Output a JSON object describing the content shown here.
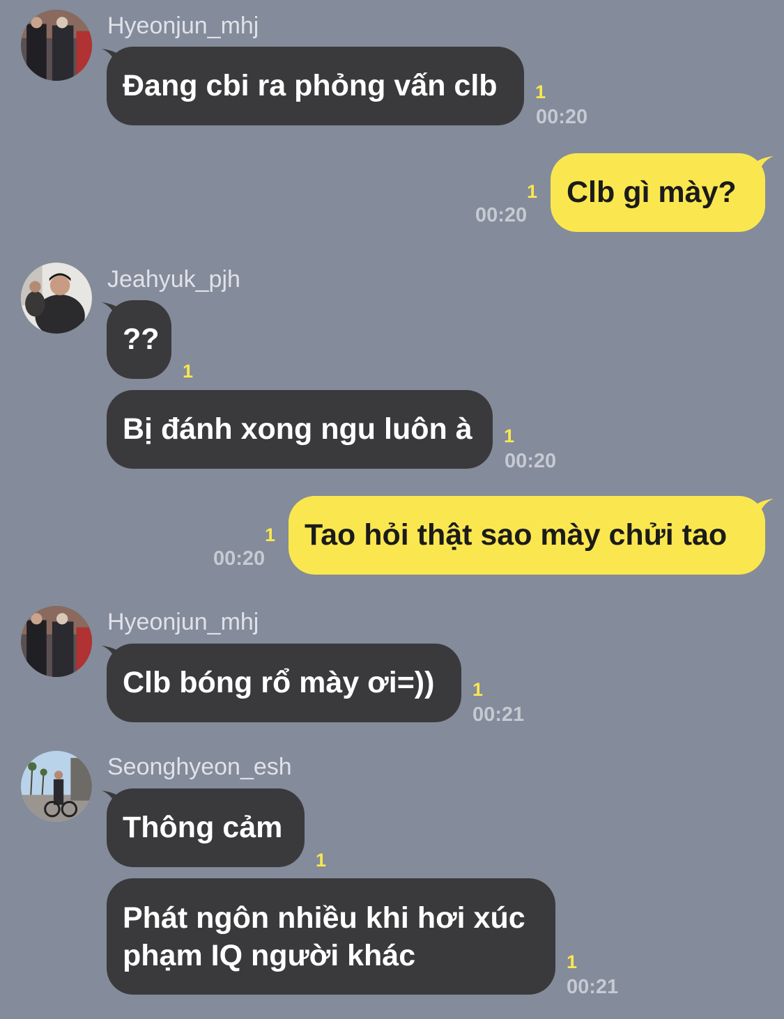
{
  "messages": [
    {
      "sender": "Hyeonjun_mhj",
      "text": "Đang cbi ra phỏng vấn clb",
      "unread": "1",
      "time": "00:20"
    },
    {
      "text": "Clb gì mày?",
      "unread": "1",
      "time": "00:20"
    },
    {
      "sender": "Jeahyuk_pjh",
      "text": "??",
      "unread": "1"
    },
    {
      "text": "Bị đánh xong ngu luôn à",
      "unread": "1",
      "time": "00:20"
    },
    {
      "text": "Tao hỏi thật sao mày chửi tao",
      "unread": "1",
      "time": "00:20"
    },
    {
      "sender": "Hyeonjun_mhj",
      "text": "Clb bóng rổ mày ơi=))",
      "unread": "1",
      "time": "00:21"
    },
    {
      "sender": "Seonghyeon_esh",
      "text": "Thông cảm",
      "unread": "1"
    },
    {
      "line1": "Phát ngôn nhiều khi hơi xúc",
      "line2": "phạm IQ người khác",
      "unread": "1",
      "time": "00:21"
    }
  ],
  "colors": {
    "background": "#848b9a",
    "incoming_bubble": "#3a3a3c",
    "outgoing_bubble": "#fae74f",
    "unread_count": "#fae74f",
    "timestamp": "#c6cad2"
  }
}
